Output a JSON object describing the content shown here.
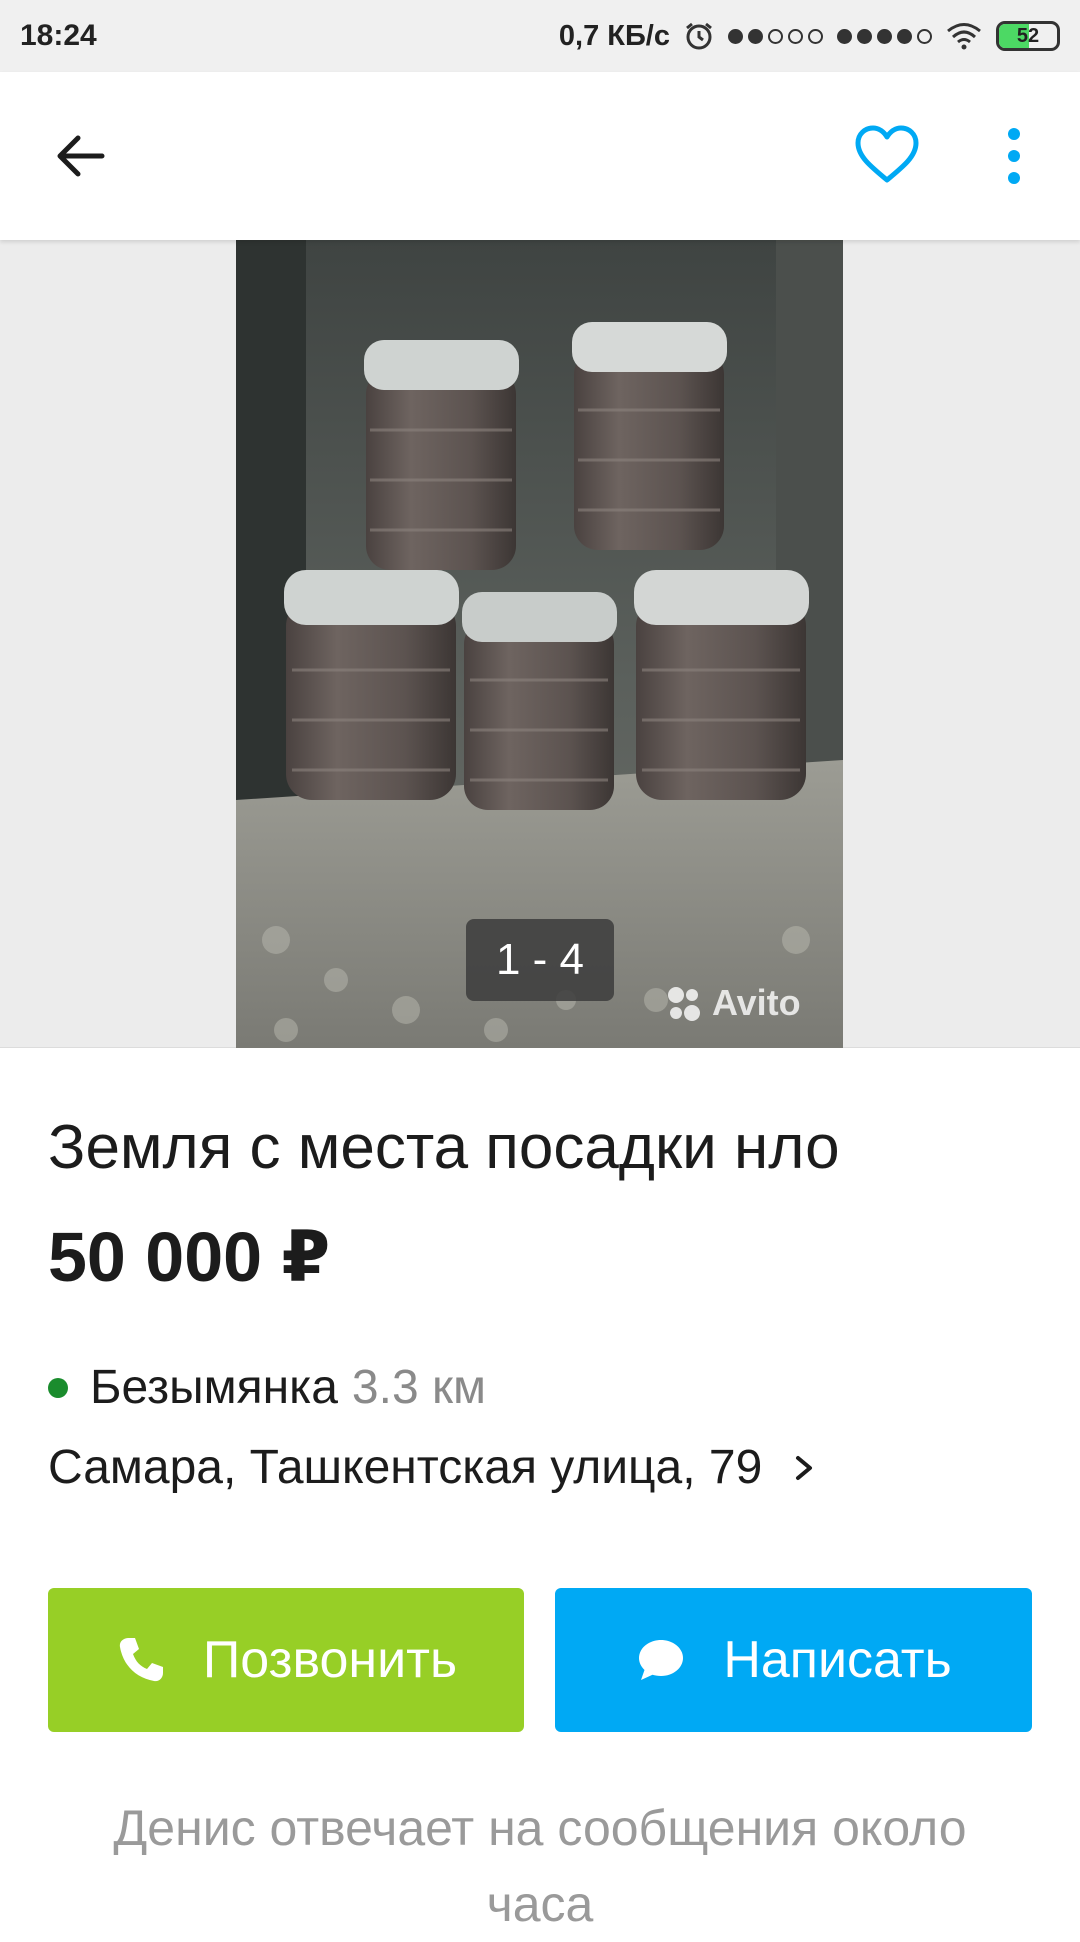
{
  "status_bar": {
    "time": "18:24",
    "speed": "0,7 КБ/с",
    "battery": "52",
    "battery_level_percent": 52,
    "signal_sim1_filled": 2,
    "signal_sim2_filled": 4,
    "signal_dots_total": 5
  },
  "app_bar": {
    "back_icon": "arrow-left-icon",
    "favorite_icon": "heart-outline-icon",
    "menu_icon": "more-vertical-icon",
    "accent_color": "#00a9f4"
  },
  "gallery": {
    "counter": "1 - 4",
    "watermark": "Avito"
  },
  "listing": {
    "title": "Земля с места посадки нло",
    "price": "50 000 ₽",
    "metro_station": "Безымянка",
    "metro_distance": "3.3 км",
    "metro_color": "#1a8c2d",
    "address": "Самара, Ташкентская улица, 79"
  },
  "actions": {
    "call_label": "Позвонить",
    "call_color": "#97cf26",
    "call_icon": "phone-icon",
    "write_label": "Написать",
    "write_color": "#00a9f4",
    "write_icon": "chat-bubble-icon"
  },
  "seller_note": "Денис отвечает на сообщения около часа"
}
